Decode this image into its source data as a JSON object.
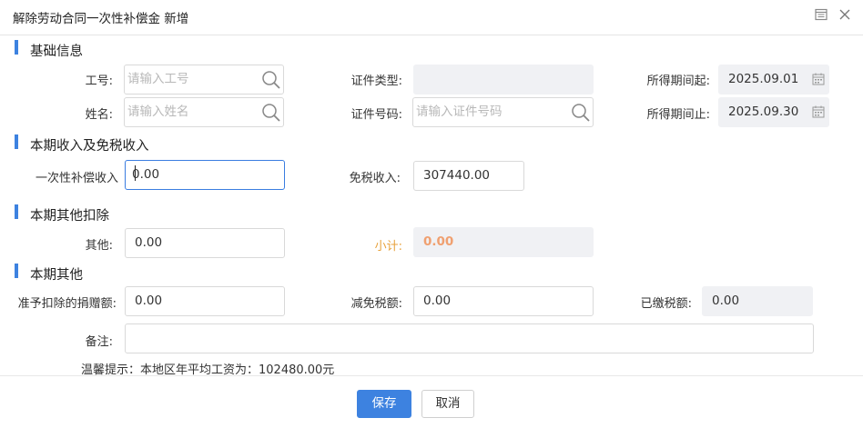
{
  "header": {
    "title": "解除劳动合同一次性补偿金 新增"
  },
  "sections": {
    "basic": "基础信息",
    "income": "本期收入及免税收入",
    "deduction": "本期其他扣除",
    "other": "本期其他"
  },
  "basic": {
    "emp_no_label": "工号:",
    "emp_no_placeholder": "请输入工号",
    "name_label": "姓名:",
    "name_placeholder": "请输入姓名",
    "id_type_label": "证件类型:",
    "id_type_value": "",
    "id_no_label": "证件号码:",
    "id_no_placeholder": "请输入证件号码",
    "period_start_label": "所得期间起:",
    "period_start_value": "2025.09.01",
    "period_end_label": "所得期间止:",
    "period_end_value": "2025.09.30"
  },
  "income": {
    "lump_sum_label": "一次性补偿收入",
    "lump_sum_value": "0.00",
    "tax_free_label": "免税收入:",
    "tax_free_value": "307440.00"
  },
  "deduction": {
    "other_label": "其他:",
    "other_value": "0.00",
    "subtotal_label": "小计:",
    "subtotal_value": "0.00"
  },
  "other": {
    "donation_label": "准予扣除的捐赠额:",
    "donation_value": "0.00",
    "tax_relief_label": "减免税额:",
    "tax_relief_value": "0.00",
    "tax_paid_label": "已缴税额:",
    "tax_paid_value": "0.00",
    "remark_label": "备注:",
    "remark_value": ""
  },
  "tip": "温馨提示：本地区年平均工资为：102480.00元",
  "footer": {
    "save_label": "保存",
    "cancel_label": "取消"
  },
  "colors": {
    "accent": "#3d82e0",
    "subtotal_label": "#e8a23d",
    "subtotal_value": "#f0a070",
    "readonly_bg": "#f0f1f4"
  },
  "icons": {
    "header_left": "maximize-icon",
    "header_right": "close-icon",
    "search": "search-icon",
    "calendar": "calendar-icon"
  }
}
